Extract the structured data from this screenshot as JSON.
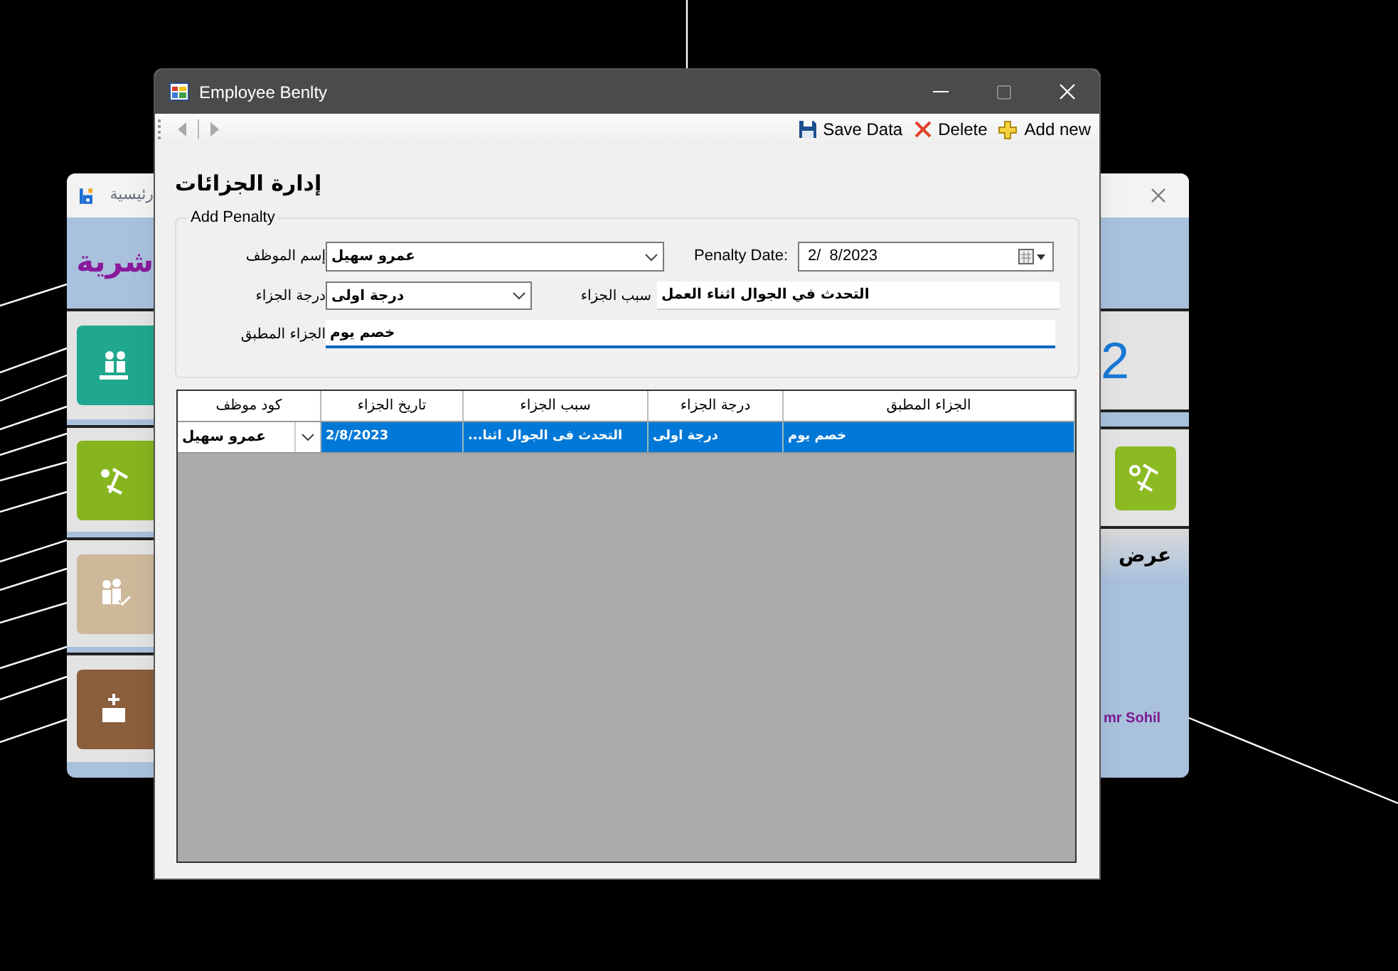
{
  "background_window": {
    "title": "رئيسية",
    "heading": "شرية",
    "number": "2",
    "caption": "عرض",
    "user": "mr Sohil"
  },
  "window": {
    "title": "Employee Benlty"
  },
  "navigation": [
    {
      "kind": "back",
      "disabled": true
    },
    {
      "kind": "forward",
      "disabled": true
    }
  ],
  "actions": [
    {
      "kind": "add",
      "label": "Add new"
    },
    {
      "kind": "delete",
      "label": "Delete"
    },
    {
      "kind": "save",
      "label": "Save Data"
    }
  ],
  "heading": "إدارة الجزائات",
  "form": {
    "title": "Add Penalty",
    "employee": {
      "label": "إسم الموظف",
      "value": "عمرو سهيل"
    },
    "date": {
      "label": "Penalty Date:",
      "value": "2/  8/2023"
    },
    "degree": {
      "label": "درجة الجزاء",
      "value": "درجة اولى"
    },
    "reason": {
      "label": "سبب الجزاء",
      "value": "التحدث في الجوال اثناء العمل"
    },
    "applied": {
      "label": "الجزاء المطبق",
      "value": "خصم يوم",
      "focused": true
    }
  },
  "table": {
    "columns": [
      "الجزاء المطبق",
      "درجة الجزاء",
      "سبب الجزاء",
      "تاريخ الجزاء",
      "كود موظف"
    ],
    "rows": [
      {
        "selected": true,
        "cells": [
          "خصم يوم",
          "درجة اولى",
          "التحدث فى الجوال اثنا...",
          "2/8/2023",
          "عمرو سهيل"
        ]
      }
    ]
  }
}
